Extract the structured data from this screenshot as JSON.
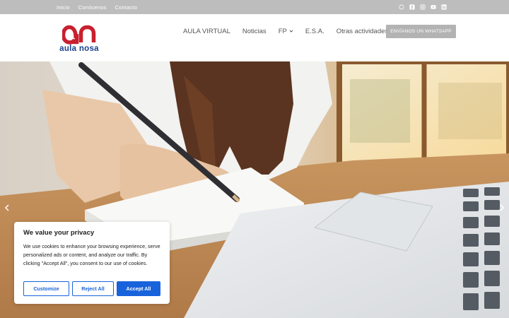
{
  "top_bar": {
    "links": [
      "Inicio",
      "Conócenos",
      "Contacto"
    ],
    "social_icons": [
      "whatsapp-icon",
      "facebook-icon",
      "instagram-icon",
      "youtube-icon",
      "linkedin-icon"
    ]
  },
  "header": {
    "logo_text": "aula nosa",
    "logo_colors": {
      "mark": "#c8202f",
      "text": "#17408b"
    },
    "nav": [
      {
        "label": "AULA VIRTUAL"
      },
      {
        "label": "Noticias"
      },
      {
        "label": "FP",
        "has_dropdown": true
      },
      {
        "label": "E.S.A."
      },
      {
        "label": "Otras actividades"
      }
    ],
    "whatsapp_button": "ENVÍANOS UN WHATSAPP"
  },
  "hero": {
    "arrows": [
      "chevron-left-icon",
      "chevron-right-icon"
    ]
  },
  "cookie_banner": {
    "title": "We value your privacy",
    "text": "We use cookies to enhance your browsing experience, serve personalized ads or content, and analyze our traffic. By clicking \"Accept All\", you consent to our use of cookies.",
    "buttons": {
      "customize": "Customize",
      "reject": "Reject All",
      "accept": "Accept All"
    },
    "accent_color": "#1863dc"
  }
}
